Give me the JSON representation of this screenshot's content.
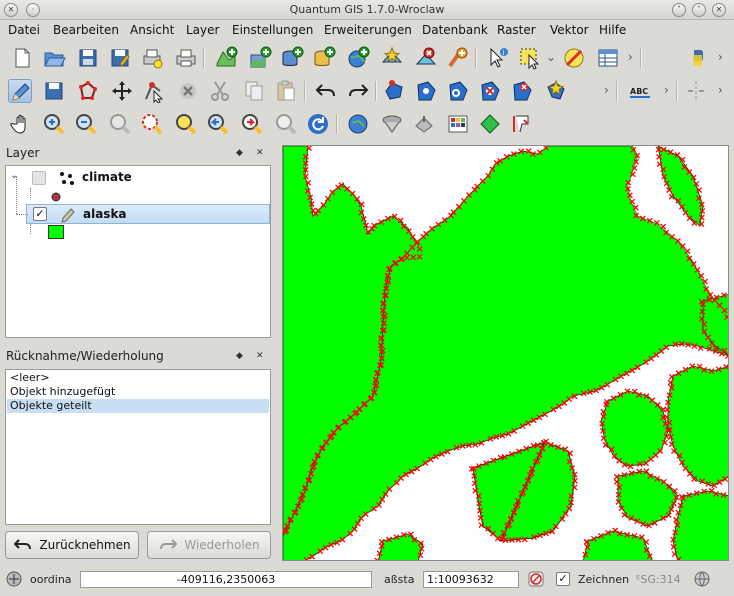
{
  "window": {
    "title": "Quantum GIS 1.7.0-Wroclaw"
  },
  "menu": [
    "Datei",
    "Bearbeiten",
    "Ansicht",
    "Layer",
    "Einstellungen",
    "Erweiterungen",
    "Datenbank",
    "Raster",
    "Vektor",
    "Hilfe"
  ],
  "layer_panel": {
    "title": "Layer",
    "layers": [
      {
        "name": "climate",
        "checked": false,
        "symbol_color": "#b03050"
      },
      {
        "name": "alaska",
        "checked": true,
        "symbol_color": "#00ff00"
      }
    ]
  },
  "undo_panel": {
    "title": "Rücknahme/Wiederholung",
    "items": [
      "<leer>",
      "Objekt hinzugefügt",
      "Objekte geteilt"
    ],
    "selected": 2,
    "undo_label": "Zurücknehmen",
    "redo_label": "Wiederholen"
  },
  "status": {
    "coord_label": "oordina",
    "coordinate": "-409116,2350063",
    "scale_label": "aßsta",
    "scale": "1:10093632",
    "render_label": "Zeichnen",
    "crs": "ᴱSG:314"
  },
  "colors": {
    "polygon_fill": "#00ff00",
    "vertex_marker": "#ff0000",
    "selection": "#c4dcf3"
  },
  "icons": {
    "toolbar1": [
      "new-project-icon",
      "open-project-icon",
      "save-project-icon",
      "save-as-icon",
      "print-composer-icon",
      "print-icon",
      "add-vector-icon",
      "add-raster-icon",
      "add-postgis-icon",
      "add-spatialite-icon",
      "add-wms-icon",
      "new-layer-icon",
      "remove-layer-icon",
      "new-shapefile-icon",
      "identify-icon",
      "select-icon",
      "deselect-icon",
      "attribute-table-icon",
      "python-icon"
    ],
    "toolbar2": [
      "toggle-edit-icon",
      "save-edits-icon",
      "capture-polygon-icon",
      "move-feature-icon",
      "node-tool-icon",
      "delete-selected-icon",
      "cut-icon",
      "copy-icon",
      "paste-icon",
      "undo-icon",
      "redo-icon",
      "simplify-icon",
      "add-ring-icon",
      "add-part-icon",
      "delete-ring-icon",
      "delete-part-icon",
      "reshape-icon",
      "label-icon",
      "split-icon"
    ],
    "toolbar3": [
      "pan-icon",
      "zoom-in-icon",
      "zoom-out-icon",
      "zoom-full-icon",
      "zoom-layer-icon",
      "zoom-selection-icon",
      "zoom-last-icon",
      "zoom-next-icon",
      "zoom-actual-icon",
      "refresh-icon",
      "gps-icon",
      "georeferencer-icon",
      "plugin-icon",
      "raster-calc-icon",
      "measure-icon",
      "measure-area-icon"
    ]
  }
}
